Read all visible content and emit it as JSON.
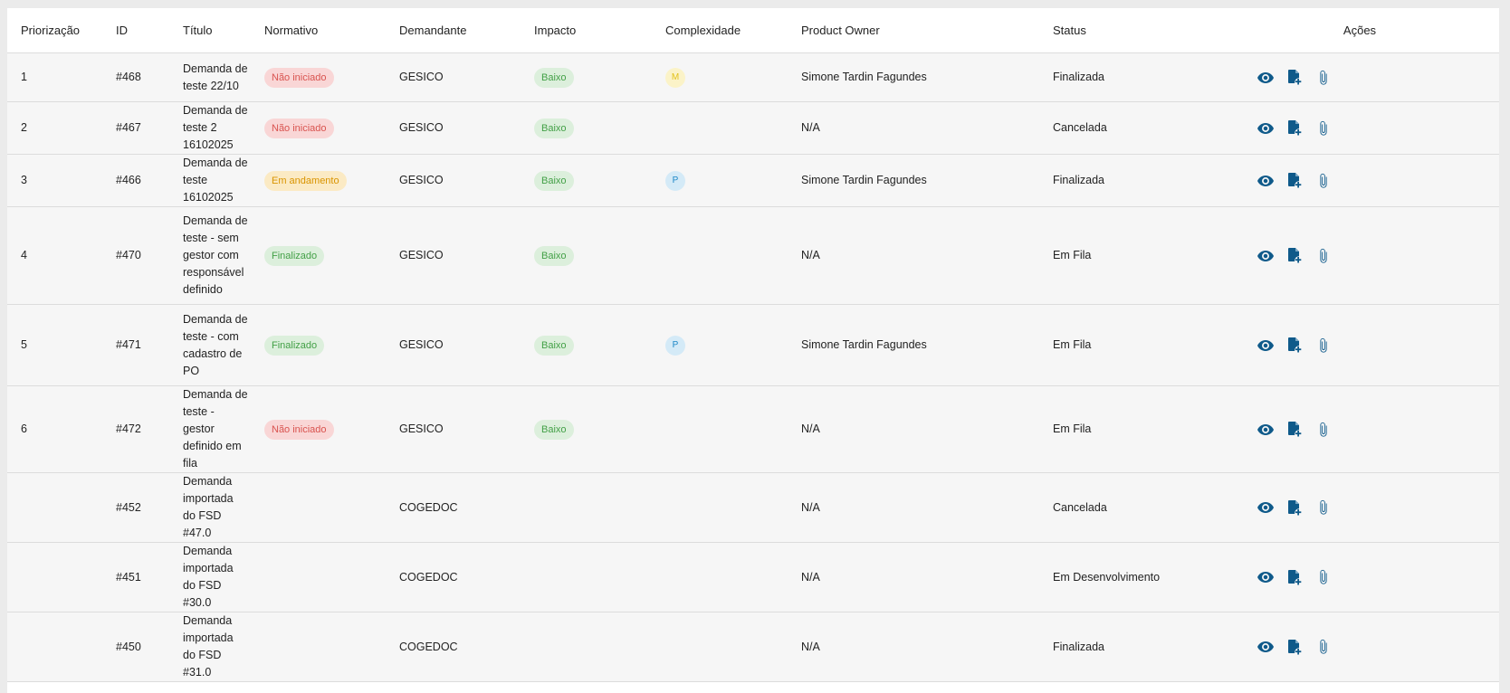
{
  "colors": {
    "accent": "#0f5a8a",
    "chip_red_bg": "#f9d6d6",
    "chip_red_fg": "#d9534f",
    "chip_yellow_bg": "#fbeac4",
    "chip_yellow_fg": "#d99400",
    "chip_green_bg": "#dcefdc",
    "chip_green_fg": "#43a047"
  },
  "table": {
    "headers": {
      "priorizacao": "Priorização",
      "id": "ID",
      "titulo": "Título",
      "normativo": "Normativo",
      "demandante": "Demandante",
      "impacto": "Impacto",
      "complexidade": "Complexidade",
      "product_owner": "Product Owner",
      "status": "Status",
      "acoes": "Ações"
    },
    "action_icons": [
      "visibility-icon",
      "file-add-icon",
      "attachment-icon"
    ],
    "rows": [
      {
        "priorizacao": "1",
        "id": "#468",
        "titulo": "Demanda de teste 22/10",
        "normativo": "Não iniciado",
        "normativo_color": "red",
        "demandante": "GESICO",
        "impacto": "Baixo",
        "complexidade": "M",
        "complexidade_color": "yellow",
        "product_owner": "Simone Tardin Fagundes",
        "status": "Finalizada"
      },
      {
        "priorizacao": "2",
        "id": "#467",
        "titulo": "Demanda de teste 2 16102025",
        "normativo": "Não iniciado",
        "normativo_color": "red",
        "demandante": "GESICO",
        "impacto": "Baixo",
        "complexidade": "",
        "complexidade_color": "",
        "product_owner": "N/A",
        "status": "Cancelada"
      },
      {
        "priorizacao": "3",
        "id": "#466",
        "titulo": "Demanda de teste 16102025",
        "normativo": "Em andamento",
        "normativo_color": "yellow",
        "demandante": "GESICO",
        "impacto": "Baixo",
        "complexidade": "P",
        "complexidade_color": "blue",
        "product_owner": "Simone Tardin Fagundes",
        "status": "Finalizada"
      },
      {
        "priorizacao": "4",
        "id": "#470",
        "titulo": "Demanda de teste - sem gestor com responsável definido",
        "normativo": "Finalizado",
        "normativo_color": "green",
        "demandante": "GESICO",
        "impacto": "Baixo",
        "complexidade": "",
        "complexidade_color": "",
        "product_owner": "N/A",
        "status": "Em Fila"
      },
      {
        "priorizacao": "5",
        "id": "#471",
        "titulo": "Demanda de teste - com cadastro de PO",
        "normativo": "Finalizado",
        "normativo_color": "green",
        "demandante": "GESICO",
        "impacto": "Baixo",
        "complexidade": "P",
        "complexidade_color": "blue",
        "product_owner": "Simone Tardin Fagundes",
        "status": "Em Fila"
      },
      {
        "priorizacao": "6",
        "id": "#472",
        "titulo": "Demanda de teste - gestor definido em fila",
        "normativo": "Não iniciado",
        "normativo_color": "red",
        "demandante": "GESICO",
        "impacto": "Baixo",
        "complexidade": "",
        "complexidade_color": "",
        "product_owner": "N/A",
        "status": "Em Fila"
      },
      {
        "priorizacao": "",
        "id": "#452",
        "titulo": "Demanda importada do FSD #47.0",
        "normativo": "",
        "normativo_color": "",
        "demandante": "COGEDOC",
        "impacto": "",
        "complexidade": "",
        "complexidade_color": "",
        "product_owner": "N/A",
        "status": "Cancelada"
      },
      {
        "priorizacao": "",
        "id": "#451",
        "titulo": "Demanda importada do FSD #30.0",
        "normativo": "",
        "normativo_color": "",
        "demandante": "COGEDOC",
        "impacto": "",
        "complexidade": "",
        "complexidade_color": "",
        "product_owner": "N/A",
        "status": "Em Desenvolvimento"
      },
      {
        "priorizacao": "",
        "id": "#450",
        "titulo": "Demanda importada do FSD #31.0",
        "normativo": "",
        "normativo_color": "",
        "demandante": "COGEDOC",
        "impacto": "",
        "complexidade": "",
        "complexidade_color": "",
        "product_owner": "N/A",
        "status": "Finalizada"
      }
    ]
  }
}
